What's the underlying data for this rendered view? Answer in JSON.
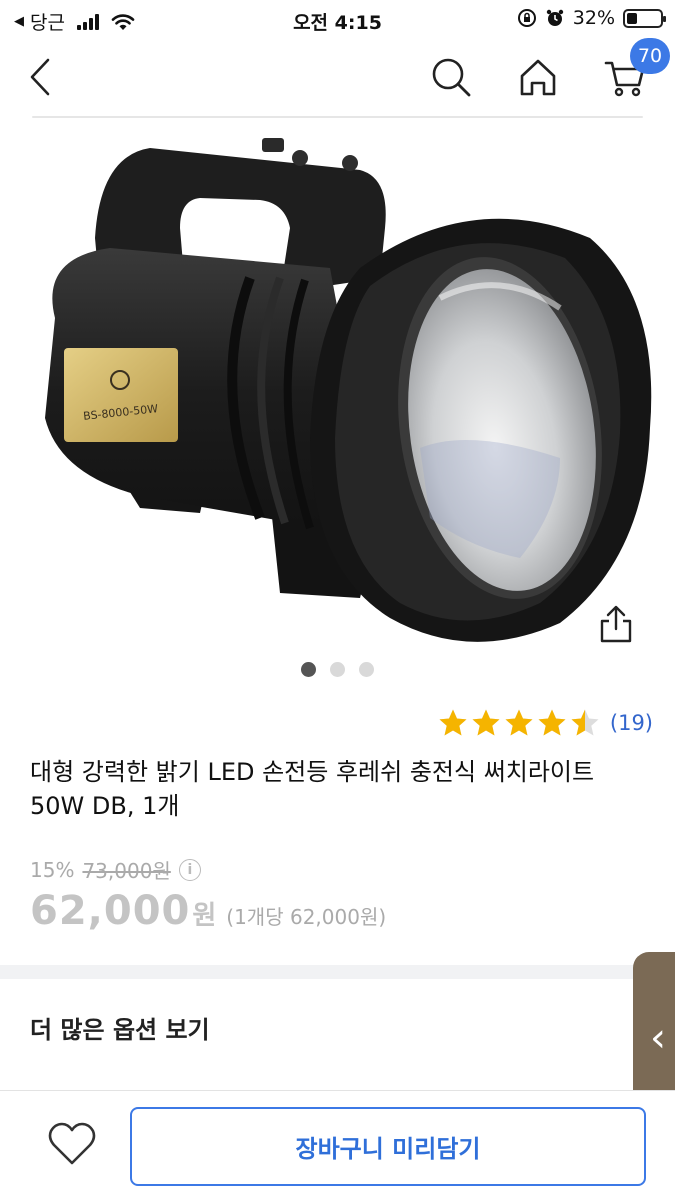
{
  "status_bar": {
    "back_app": "당근",
    "time": "오전 4:15",
    "battery_percent": "32%",
    "battery_level": 0.32
  },
  "nav": {
    "back_icon": "chevron-left-icon",
    "search_icon": "search-icon",
    "home_icon": "home-icon",
    "cart_icon": "cart-icon",
    "cart_count": "70"
  },
  "gallery": {
    "image": "flashlight-product-image",
    "label_text": "BS-8000-50W",
    "page_count": 3,
    "active_page": 1
  },
  "rating": {
    "stars": 4.5,
    "review_count": "(19)",
    "star_color": "#f5b400"
  },
  "product": {
    "title": "대형 강력한 밝기 LED 손전등 후레쉬 충전식 써치라이트 50W DB, 1개",
    "discount": "15%",
    "original_price": "73,000원",
    "price": "62,000",
    "price_unit": "원",
    "unit_price": "(1개당 62,000원)"
  },
  "options": {
    "heading": "더 많은 옵션 보기"
  },
  "side_tab": {
    "glyph": "‹"
  },
  "bottom_bar": {
    "wishlist_icon": "heart-icon",
    "cart_button": "장바구니 미리담기",
    "accent": "#3c79e6"
  }
}
